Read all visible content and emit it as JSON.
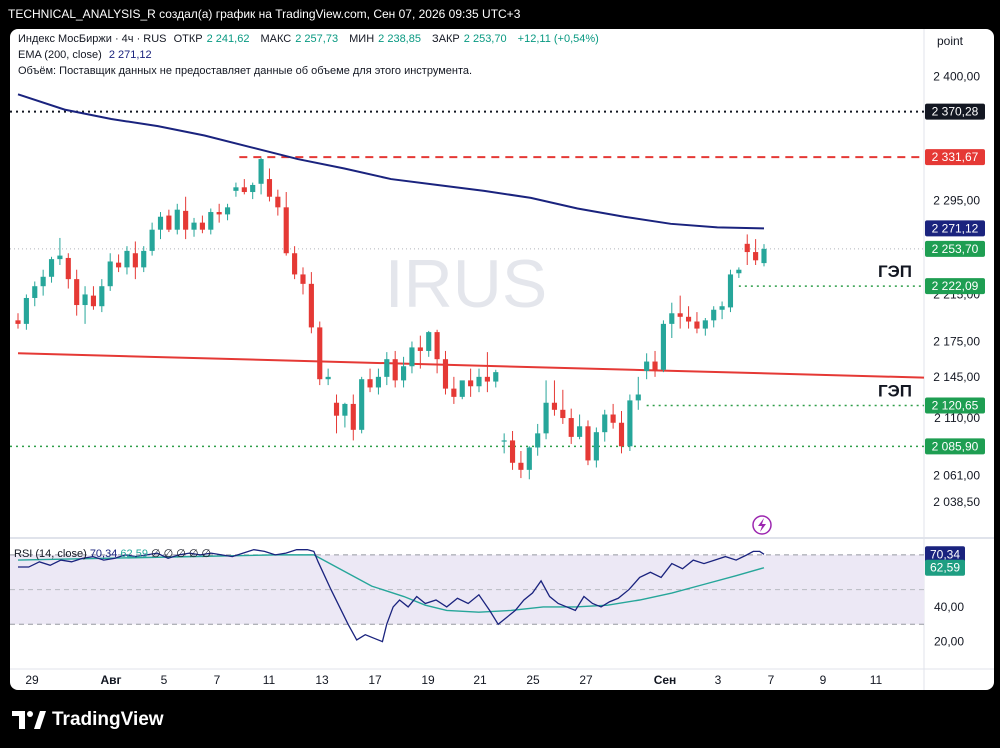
{
  "header": {
    "attribution": "TECHNICAL_ANALYSIS_R создал(а) график на TradingView.com, Сен 07, 2026 09:35 UTC+3"
  },
  "legend": {
    "title": "Индекс МосБиржи · 4ч · RUS",
    "ohlc": [
      {
        "label": "ОТКР",
        "value": "2 241,62"
      },
      {
        "label": "МАКС",
        "value": "2 257,73"
      },
      {
        "label": "МИН",
        "value": "2 238,85"
      },
      {
        "label": "ЗАКР",
        "value": "2 253,70"
      }
    ],
    "change": "+12,11 (+0,54%)",
    "ema_label": "EMA (200, close)",
    "ema_value": "2 271,12",
    "volume_note": "Объём: Поставщик данных не предоставляет данные об объеме для этого инструмента."
  },
  "watermark": "IRUS",
  "axis_unit": "point",
  "footer": {
    "brand": "TradingView"
  },
  "rsi": {
    "label": "RSI (14, close)",
    "value": "70,34",
    "ma_value": "62,59",
    "na": "∅ ∅ ∅ ∅ ∅"
  },
  "colors": {
    "up": "#26a69a",
    "down": "#e53935",
    "ema": "#1a237e",
    "trend": "#e53935",
    "gap": "#2e9e49",
    "resistance": "#e53935",
    "rsi": "#1a237e",
    "rsi_ma": "#26a69a",
    "rsi_band": "#ece8f5"
  },
  "chart_data": {
    "type": "candlestick",
    "price_axis": {
      "range": [
        2020,
        2415
      ],
      "ticks": [
        "2 400,00",
        "2 295,00",
        "2 215,00",
        "2 175,00",
        "2 145,00",
        "2 110,00",
        "2 061,00",
        "2 038,50"
      ],
      "tick_values": [
        2400,
        2295,
        2215,
        2175,
        2145,
        2110,
        2061,
        2038.5
      ]
    },
    "time_axis": {
      "labels": [
        "29",
        "Авг",
        "5",
        "7",
        "11",
        "13",
        "17",
        "19",
        "21",
        "25",
        "27",
        "Сен",
        "3",
        "7",
        "9",
        "11"
      ]
    },
    "candles": [
      [
        2193,
        2199,
        2186,
        2190
      ],
      [
        2190,
        2215,
        2185,
        2212
      ],
      [
        2212,
        2226,
        2205,
        2222
      ],
      [
        2222,
        2236,
        2214,
        2230
      ],
      [
        2230,
        2247,
        2225,
        2245
      ],
      [
        2245,
        2263,
        2240,
        2248
      ],
      [
        2246,
        2250,
        2220,
        2228
      ],
      [
        2228,
        2236,
        2197,
        2206
      ],
      [
        2206,
        2222,
        2190,
        2215
      ],
      [
        2214,
        2222,
        2202,
        2205
      ],
      [
        2205,
        2228,
        2200,
        2222
      ],
      [
        2222,
        2250,
        2218,
        2243
      ],
      [
        2242,
        2249,
        2234,
        2238
      ],
      [
        2238,
        2256,
        2232,
        2252
      ],
      [
        2250,
        2260,
        2228,
        2238
      ],
      [
        2238,
        2256,
        2234,
        2252
      ],
      [
        2252,
        2276,
        2248,
        2270
      ],
      [
        2270,
        2285,
        2262,
        2281
      ],
      [
        2282,
        2287,
        2268,
        2270
      ],
      [
        2270,
        2292,
        2266,
        2287
      ],
      [
        2286,
        2298,
        2262,
        2270
      ],
      [
        2270,
        2280,
        2264,
        2276
      ],
      [
        2276,
        2282,
        2267,
        2270
      ],
      [
        2270,
        2288,
        2266,
        2285
      ],
      [
        2285,
        2292,
        2276,
        2283
      ],
      [
        2283,
        2292,
        2278,
        2289
      ],
      [
        2303,
        2310,
        2298,
        2306
      ],
      [
        2306,
        2313,
        2300,
        2302
      ],
      [
        2302,
        2310,
        2296,
        2308
      ],
      [
        2309,
        2331,
        2300,
        2330
      ],
      [
        2313,
        2322,
        2294,
        2298
      ],
      [
        2298,
        2304,
        2282,
        2289
      ],
      [
        2289,
        2302,
        2248,
        2250
      ],
      [
        2250,
        2256,
        2228,
        2232
      ],
      [
        2232,
        2238,
        2215,
        2224
      ],
      [
        2224,
        2234,
        2182,
        2187
      ],
      [
        2187,
        2192,
        2138,
        2143
      ],
      [
        2143,
        2152,
        2138,
        2145
      ],
      [
        2123,
        2130,
        2097,
        2112
      ],
      [
        2112,
        2123,
        2102,
        2122
      ],
      [
        2122,
        2130,
        2091,
        2100
      ],
      [
        2100,
        2145,
        2097,
        2143
      ],
      [
        2143,
        2152,
        2132,
        2136
      ],
      [
        2136,
        2152,
        2130,
        2145
      ],
      [
        2145,
        2166,
        2138,
        2160
      ],
      [
        2160,
        2167,
        2136,
        2142
      ],
      [
        2142,
        2162,
        2136,
        2154
      ],
      [
        2154,
        2175,
        2148,
        2170
      ],
      [
        2170,
        2180,
        2152,
        2167
      ],
      [
        2167,
        2184,
        2162,
        2183
      ],
      [
        2183,
        2185,
        2148,
        2160
      ],
      [
        2160,
        2167,
        2130,
        2135
      ],
      [
        2135,
        2145,
        2122,
        2128
      ],
      [
        2128,
        2140,
        2126,
        2142
      ],
      [
        2142,
        2152,
        2128,
        2137
      ],
      [
        2137,
        2152,
        2132,
        2145
      ],
      [
        2145,
        2166,
        2132,
        2141
      ],
      [
        2141,
        2151,
        2136,
        2149
      ],
      [
        2090,
        2097,
        2080,
        2091
      ],
      [
        2091,
        2099,
        2066,
        2072
      ],
      [
        2072,
        2082,
        2059,
        2066
      ],
      [
        2066,
        2086,
        2058,
        2085
      ],
      [
        2085,
        2105,
        2078,
        2097
      ],
      [
        2097,
        2142,
        2092,
        2123
      ],
      [
        2123,
        2142,
        2112,
        2117
      ],
      [
        2117,
        2134,
        2105,
        2110
      ],
      [
        2110,
        2118,
        2088,
        2094
      ],
      [
        2094,
        2113,
        2092,
        2103
      ],
      [
        2103,
        2108,
        2070,
        2074
      ],
      [
        2074,
        2102,
        2068,
        2098
      ],
      [
        2098,
        2117,
        2090,
        2113
      ],
      [
        2113,
        2122,
        2101,
        2106
      ],
      [
        2106,
        2116,
        2080,
        2086
      ],
      [
        2086,
        2130,
        2082,
        2125
      ],
      [
        2125,
        2145,
        2117,
        2130
      ],
      [
        2150,
        2165,
        2143,
        2158
      ],
      [
        2158,
        2167,
        2145,
        2151
      ],
      [
        2151,
        2193,
        2149,
        2190
      ],
      [
        2190,
        2208,
        2178,
        2199
      ],
      [
        2199,
        2214,
        2186,
        2196
      ],
      [
        2196,
        2205,
        2186,
        2192
      ],
      [
        2192,
        2200,
        2182,
        2186
      ],
      [
        2186,
        2195,
        2180,
        2193
      ],
      [
        2193,
        2205,
        2187,
        2202
      ],
      [
        2202,
        2209,
        2194,
        2205
      ],
      [
        2204,
        2236,
        2200,
        2232
      ],
      [
        2233,
        2238,
        2229,
        2236
      ],
      [
        2258,
        2266,
        2240,
        2251
      ],
      [
        2251,
        2262,
        2240,
        2244
      ],
      [
        2241.62,
        2257.73,
        2238.85,
        2253.7
      ]
    ],
    "ema200": [
      [
        0,
        2385
      ],
      [
        30,
        2372
      ],
      [
        60,
        2364
      ],
      [
        90,
        2358
      ],
      [
        120,
        2350
      ],
      [
        150,
        2340
      ],
      [
        180,
        2330
      ],
      [
        210,
        2322
      ],
      [
        240,
        2313
      ],
      [
        270,
        2308
      ],
      [
        300,
        2303
      ],
      [
        330,
        2297
      ],
      [
        360,
        2288
      ],
      [
        390,
        2281
      ],
      [
        420,
        2275
      ],
      [
        450,
        2272
      ],
      [
        480,
        2271.12
      ]
    ],
    "trendline": [
      [
        0,
        2165
      ],
      [
        480,
        2148
      ]
    ],
    "levels": [
      {
        "value": 2370.28,
        "label": "2 370,28",
        "style": "dotted-black"
      },
      {
        "value": 2331.67,
        "label": "2 331,67",
        "style": "dashed-red"
      },
      {
        "value": 2271.12,
        "label": "2 271,12",
        "style": "ema"
      },
      {
        "value": 2253.7,
        "label": "2 253,70",
        "style": "last"
      },
      {
        "value": 2222.09,
        "label": "2 222,09",
        "style": "gap"
      },
      {
        "value": 2120.65,
        "label": "2 120,65",
        "style": "gap"
      },
      {
        "value": 2085.9,
        "label": "2 085,90",
        "style": "gap"
      }
    ],
    "annotations": [
      {
        "text": "ГЭП",
        "near": 2222.09
      },
      {
        "text": "ГЭП",
        "near": 2120.65
      }
    ],
    "rsi_axis": {
      "range": [
        10,
        78
      ],
      "ticks": [
        "40,00",
        "20,00"
      ],
      "tick_values": [
        40,
        20
      ],
      "overbought": 70,
      "oversold": 30
    },
    "rsi": [
      [
        0,
        63
      ],
      [
        5,
        63
      ],
      [
        10,
        66
      ],
      [
        15,
        64
      ],
      [
        20,
        67
      ],
      [
        25,
        66
      ],
      [
        30,
        68
      ],
      [
        35,
        69
      ],
      [
        40,
        67
      ],
      [
        45,
        68
      ],
      [
        50,
        70
      ],
      [
        55,
        69
      ],
      [
        60,
        70
      ],
      [
        65,
        71
      ],
      [
        70,
        68
      ],
      [
        75,
        70
      ],
      [
        80,
        71
      ],
      [
        85,
        70
      ],
      [
        90,
        71
      ],
      [
        95,
        70
      ],
      [
        100,
        69
      ],
      [
        105,
        71
      ],
      [
        110,
        73
      ],
      [
        115,
        72
      ],
      [
        120,
        70
      ],
      [
        125,
        71
      ],
      [
        130,
        73
      ],
      [
        135,
        73
      ],
      [
        138,
        72
      ],
      [
        140,
        66
      ],
      [
        143,
        58
      ],
      [
        146,
        50
      ],
      [
        150,
        40
      ],
      [
        154,
        30
      ],
      [
        158,
        21
      ],
      [
        162,
        24
      ],
      [
        166,
        22
      ],
      [
        170,
        20
      ],
      [
        172,
        30
      ],
      [
        175,
        40
      ],
      [
        178,
        44
      ],
      [
        182,
        40
      ],
      [
        186,
        46
      ],
      [
        190,
        42
      ],
      [
        195,
        44
      ],
      [
        200,
        40
      ],
      [
        205,
        45
      ],
      [
        210,
        42
      ],
      [
        215,
        47
      ],
      [
        220,
        38
      ],
      [
        224,
        30
      ],
      [
        228,
        34
      ],
      [
        232,
        38
      ],
      [
        236,
        44
      ],
      [
        240,
        48
      ],
      [
        244,
        55
      ],
      [
        248,
        46
      ],
      [
        252,
        42
      ],
      [
        256,
        40
      ],
      [
        260,
        38
      ],
      [
        264,
        46
      ],
      [
        268,
        42
      ],
      [
        272,
        40
      ],
      [
        276,
        43
      ],
      [
        280,
        45
      ],
      [
        285,
        50
      ],
      [
        290,
        57
      ],
      [
        295,
        60
      ],
      [
        300,
        57
      ],
      [
        305,
        65
      ],
      [
        310,
        62
      ],
      [
        315,
        67
      ],
      [
        320,
        65
      ],
      [
        325,
        67
      ],
      [
        330,
        69
      ],
      [
        335,
        67
      ],
      [
        340,
        70
      ],
      [
        343,
        72
      ],
      [
        346,
        72
      ],
      [
        348,
        70.34
      ]
    ],
    "rsi_ma": [
      [
        0,
        67
      ],
      [
        40,
        68
      ],
      [
        80,
        69
      ],
      [
        120,
        70
      ],
      [
        138,
        70
      ],
      [
        150,
        62
      ],
      [
        165,
        52
      ],
      [
        180,
        46
      ],
      [
        190,
        41
      ],
      [
        200,
        38
      ],
      [
        215,
        37
      ],
      [
        230,
        38
      ],
      [
        245,
        40
      ],
      [
        260,
        40
      ],
      [
        275,
        41
      ],
      [
        290,
        44
      ],
      [
        305,
        48
      ],
      [
        320,
        53
      ],
      [
        335,
        58
      ],
      [
        348,
        62.59
      ]
    ]
  }
}
